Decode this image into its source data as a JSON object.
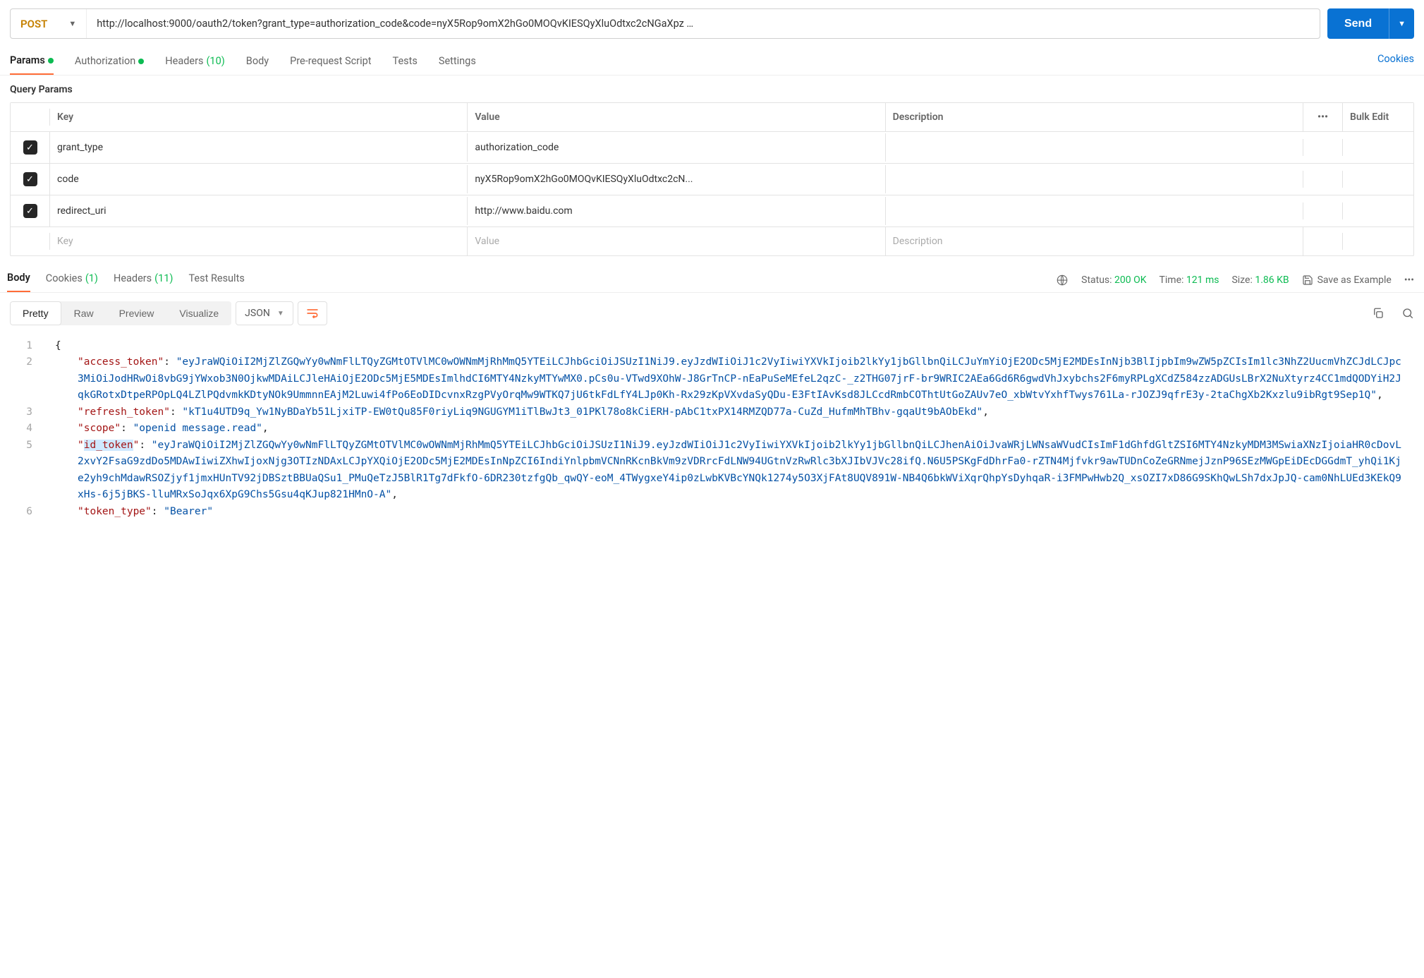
{
  "request": {
    "method": "POST",
    "url": "http://localhost:9000/oauth2/token?grant_type=authorization_code&code=nyX5Rop9omX2hGo0MOQvKIESQyXluOdtxc2cNGaXpz …",
    "send_label": "Send"
  },
  "request_tabs": {
    "params": "Params",
    "authorization": "Authorization",
    "headers": "Headers",
    "headers_count": "(10)",
    "body": "Body",
    "prerequest": "Pre-request Script",
    "tests": "Tests",
    "settings": "Settings",
    "cookies": "Cookies"
  },
  "query_params": {
    "title": "Query Params",
    "header_key": "Key",
    "header_value": "Value",
    "header_description": "Description",
    "bulk_edit": "Bulk Edit",
    "rows": [
      {
        "key": "grant_type",
        "value": "authorization_code",
        "description": ""
      },
      {
        "key": "code",
        "value": "nyX5Rop9omX2hGo0MOQvKIESQyXluOdtxc2cN...",
        "description": ""
      },
      {
        "key": "redirect_uri",
        "value": "http://www.baidu.com",
        "description": ""
      }
    ],
    "placeholder_key": "Key",
    "placeholder_value": "Value",
    "placeholder_description": "Description"
  },
  "response_tabs": {
    "body": "Body",
    "cookies": "Cookies",
    "cookies_count": "(1)",
    "headers": "Headers",
    "headers_count": "(11)",
    "test_results": "Test Results"
  },
  "response_meta": {
    "status_label": "Status:",
    "status_value": "200 OK",
    "time_label": "Time:",
    "time_value": "121 ms",
    "size_label": "Size:",
    "size_value": "1.86 KB",
    "save_label": "Save as Example"
  },
  "response_toolbar": {
    "pretty": "Pretty",
    "raw": "Raw",
    "preview": "Preview",
    "visualize": "Visualize",
    "format": "JSON"
  },
  "response_body": {
    "access_token": "eyJraWQiOiI2MjZlZGQwYy0wNmFlLTQyZGMtOTVlMC0wOWNmMjRhMmQ5YTEiLCJhbGciOiJSUzI1NiJ9.eyJzdWIiOiJ1c2VyIiwiYXVkIjoib2lkYy1jbGllbnQiLCJuYmYiOjE2ODc5MjE2MDEsInNjb3BlIjpbIm9wZW5pZCIsIm1lc3NhZ2UucmVhZCJdLCJpc3MiOiJodHRwOi8vbG9jYWxob3N0OjkwMDAiLCJleHAiOjE2ODc5MjE5MDEsImlhdCI6MTY4NzkyMTYwMX0.pCs0u-VTwd9XOhW-J8GrTnCP-nEaPuSeMEfeL2qzC-_z2THG07jrF-br9WRIC2AEa6Gd6R6gwdVhJxybchs2F6myRPLgXCdZ584zzADGUsLBrX2NuXtyrz4CC1mdQODYiH2JqkGRotxDtpeRPOpLQ4LZlPQdvmkKDtyNOk9UmmnnEAjM2Luwi4fPo6EoDIDcvnxRzgPVyOrqMw9WTKQ7jU6tkFdLfY4LJp0Kh-Rx29zKpVXvdaSyQDu-E3FtIAvKsd8JLCcdRmbCOThtUtGoZAUv7eO_xbWtvYxhfTwys761La-rJOZJ9qfrE3y-2taChgXb2Kxzlu9ibRgt9Sep1Q",
    "refresh_token": "kT1u4UTD9q_Yw1NyBDaYb51LjxiTP-EW0tQu85F0riyLiq9NGUGYM1iTlBwJt3_01PKl78o8kCiERH-pAbC1txPX14RMZQD77a-CuZd_HufmMhTBhv-gqaUt9bAObEkd",
    "scope": "openid message.read",
    "id_token": "eyJraWQiOiI2MjZlZGQwYy0wNmFlLTQyZGMtOTVlMC0wOWNmMjRhMmQ5YTEiLCJhbGciOiJSUzI1NiJ9.eyJzdWIiOiJ1c2VyIiwiYXVkIjoib2lkYy1jbGllbnQiLCJhenAiOiJvaWRjLWNsaWVudCIsImF1dGhfdGltZSI6MTY4NzkyMDM3MSwiaXNzIjoiaHR0cDovL2xvY2FsaG9zdDo5MDAwIiwiZXhwIjoxNjg3OTIzNDAxLCJpYXQiOjE2ODc5MjE2MDEsInNpZCI6IndiYnlpbmVCNnRKcnBkVm9zVDRrcFdLNW94UGtnVzRwRlc3bXJIbVJVc28ifQ.N6U5PSKgFdDhrFa0-rZTN4Mjfvkr9awTUDnCoZeGRNmejJznP96SEzMWGpEiDEcDGGdmT_yhQi1Kje2yh9chMdawRSOZjyf1jmxHUnTV92jDBSztBBUaQSu1_PMuQeTzJ5BlR1Tg7dFkfO-6DR230tzfgQb_qwQY-eoM_4TWygxeY4ip0zLwbKVBcYNQk1274y5O3XjFAt8UQV891W-NB4Q6bkWViXqrQhpYsDyhqaR-i3FMPwHwb2Q_xsOZI7xD86G9SKhQwLSh7dxJpJQ-cam0NhLUEd3KEkQ9xHs-6j5jBKS-lluMRxSoJqx6XpG9Chs5Gsu4qKJup821HMnO-A",
    "token_type": "Bearer"
  }
}
